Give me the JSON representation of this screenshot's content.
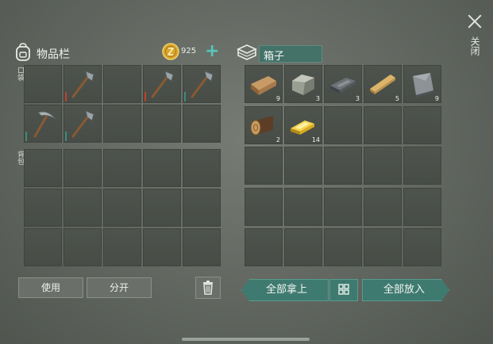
{
  "close": {
    "label": "关闭"
  },
  "inventory": {
    "title": "物品栏",
    "coins": "925",
    "add_coins": "+",
    "pocket_label": "口袋",
    "backpack_label": "背包",
    "pocket_slots": [
      {
        "item": ""
      },
      {
        "item": "hatchet-icon",
        "durability": "#c0402a"
      },
      {
        "item": ""
      },
      {
        "item": "hatchet-icon",
        "durability": "#c0402a"
      },
      {
        "item": "hatchet-icon",
        "durability": "#3d8a7f"
      },
      {
        "item": "pickaxe-icon",
        "durability": "#3d8a7f"
      },
      {
        "item": "hatchet-icon",
        "durability": "#3d8a7f"
      },
      {
        "item": ""
      },
      {
        "item": ""
      },
      {
        "item": ""
      }
    ],
    "backpack_slot_count": 15
  },
  "box": {
    "title": "箱子",
    "slots": [
      {
        "item": "wood-plank-icon",
        "count": "9"
      },
      {
        "item": "stone-icon",
        "count": "3"
      },
      {
        "item": "iron-ingot-icon",
        "count": "3"
      },
      {
        "item": "board-icon",
        "count": "5"
      },
      {
        "item": "metal-plate-icon",
        "count": "9"
      },
      {
        "item": "log-icon",
        "count": "2"
      },
      {
        "item": "gold-ingot-icon",
        "count": "14"
      }
    ],
    "empty_slot_count": 18
  },
  "buttons": {
    "use": "使用",
    "split": "分开",
    "take_all": "全部拿上",
    "put_all": "全部放入"
  },
  "colors": {
    "accent": "#55c7bd",
    "teal_button": "#3f7a70"
  }
}
